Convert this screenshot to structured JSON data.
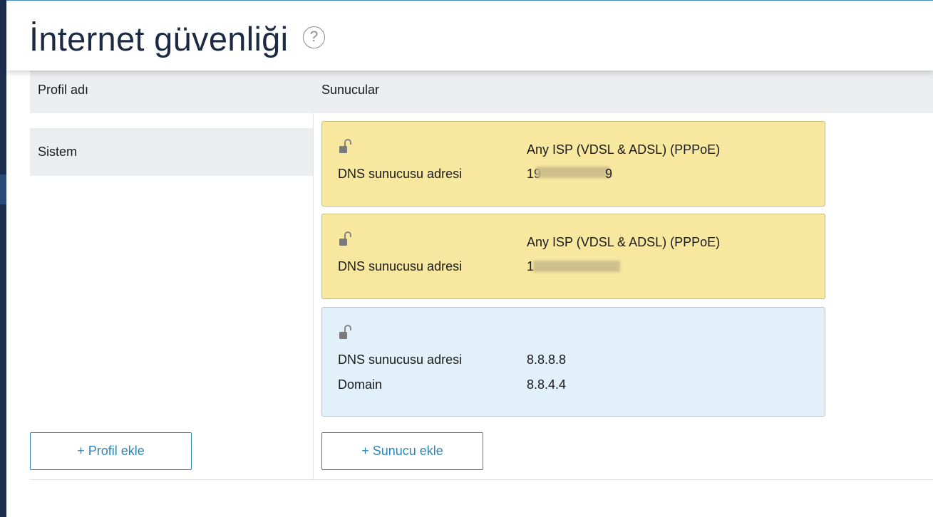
{
  "page": {
    "title": "İnternet güvenliği",
    "help_icon": "?"
  },
  "table": {
    "col_profile": "Profil adı",
    "col_servers": "Sunucular"
  },
  "profiles": [
    {
      "name": "Sistem"
    }
  ],
  "servers": [
    {
      "style": "yellow",
      "provider": "Any ISP (VDSL & ADSL) (PPPoE)",
      "rows": [
        {
          "label": "DNS sunucusu adresi",
          "value": "19"
        }
      ],
      "value_tail": "9"
    },
    {
      "style": "yellow",
      "provider": "Any ISP (VDSL & ADSL) (PPPoE)",
      "rows": [
        {
          "label": "DNS sunucusu adresi",
          "value": "1"
        }
      ]
    },
    {
      "style": "blue",
      "provider": "",
      "rows": [
        {
          "label": "DNS sunucusu adresi",
          "value": "8.8.8.8"
        },
        {
          "label": "Domain",
          "value": "8.8.4.4"
        }
      ]
    }
  ],
  "buttons": {
    "add_profile": "+ Profil ekle",
    "add_server": "+ Sunucu ekle"
  },
  "icons": {
    "lock": "unlock-icon",
    "help": "help-icon"
  },
  "colors": {
    "yellow_card": "#f8e79e",
    "blue_card": "#e2f0fa",
    "accent": "#2e86b8",
    "title": "#1c2a44",
    "header_bg": "#ecedef"
  }
}
